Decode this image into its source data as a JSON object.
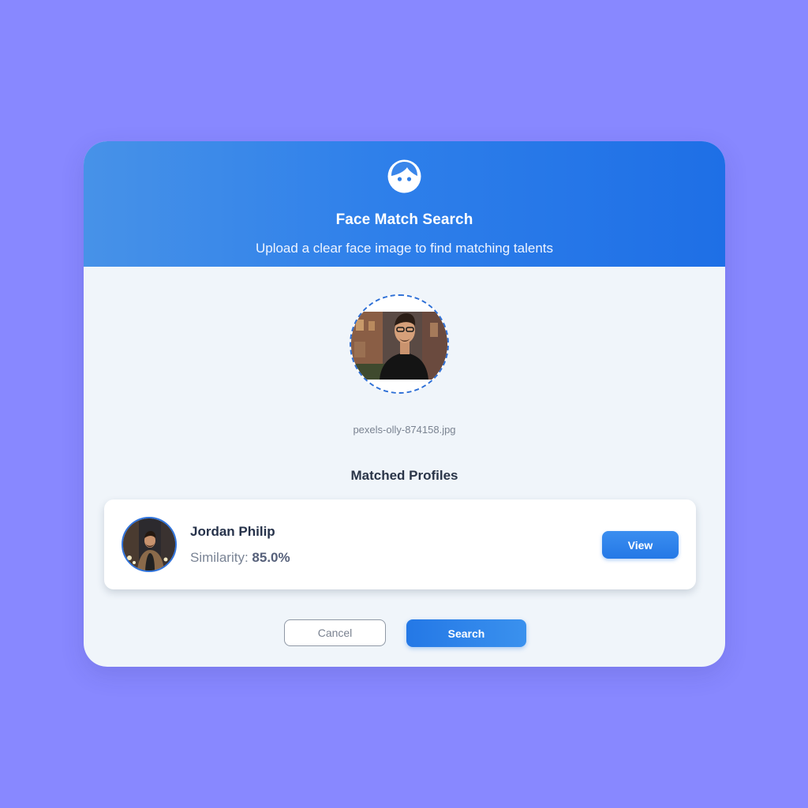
{
  "header": {
    "icon": "face-icon",
    "title": "Face Match Search",
    "subtitle": "Upload a clear face image to find matching talents"
  },
  "upload": {
    "filename": "pexels-olly-874158.jpg"
  },
  "results": {
    "title": "Matched Profiles",
    "items": [
      {
        "name": "Jordan Philip",
        "similarity_label": "Similarity:",
        "similarity_value": "85.0%",
        "view_label": "View"
      }
    ]
  },
  "actions": {
    "cancel_label": "Cancel",
    "search_label": "Search"
  },
  "colors": {
    "background": "#8888ff",
    "header_gradient_start": "#4792e8",
    "header_gradient_end": "#1e6fe6",
    "accent": "#2478e6"
  }
}
